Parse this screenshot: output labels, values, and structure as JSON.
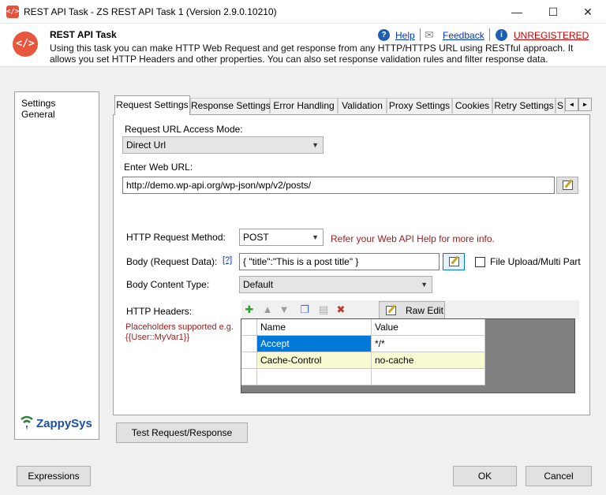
{
  "window": {
    "title": "REST API Task - ZS REST API Task 1 (Version 2.9.0.10210)",
    "app_icon": "</>",
    "controls": {
      "minimize": "—",
      "maximize": "☐",
      "close": "✕"
    }
  },
  "header": {
    "logo_glyph": "</>",
    "title": "REST API Task",
    "description": "Using this task you can make HTTP Web Request and get response from any HTTP/HTTPS URL using RESTful approach. It allows you set HTTP Headers and other properties. You can also set response validation rules and filter response data.",
    "help_label": "Help",
    "feedback_label": "Feedback",
    "unregistered_label": "UNREGISTERED",
    "help_icon": "?",
    "info_icon": "i",
    "mail_icon": "✉"
  },
  "sidebar": {
    "items": [
      {
        "label": "Settings"
      },
      {
        "label": "General"
      }
    ]
  },
  "tabs": [
    {
      "label": "Request Settings",
      "active": true
    },
    {
      "label": "Response Settings"
    },
    {
      "label": "Error Handling"
    },
    {
      "label": "Validation"
    },
    {
      "label": "Proxy Settings"
    },
    {
      "label": "Cookies"
    },
    {
      "label": "Retry Settings"
    },
    {
      "label": "S"
    }
  ],
  "tab_scroll": {
    "left": "◄",
    "right": "►"
  },
  "request": {
    "url_mode_label": "Request URL Access Mode:",
    "url_mode_value": "Direct Url",
    "web_url_label": "Enter Web URL:",
    "web_url_value": "http://demo.wp-api.org/wp-json/wp/v2/posts/",
    "method_label": "HTTP Request Method:",
    "method_value": "POST",
    "method_hint": "Refer your Web API Help for more info.",
    "body_label": "Body (Request Data):",
    "body_help": "[?]",
    "body_value": "{                \"title\":\"This is a post title\" }",
    "file_upload_label": "File Upload/Multi Part",
    "file_upload_checked": false,
    "content_type_label": "Body Content Type:",
    "content_type_value": "Default",
    "headers_label": "HTTP Headers:",
    "placeholder_hint_1": "Placeholders supported e.g.",
    "placeholder_hint_2": "{{User::MyVar1}}"
  },
  "headers_toolbar": {
    "raw_edit_label": "Raw Edit"
  },
  "headers_grid": {
    "columns": [
      "Name",
      "Value"
    ],
    "rows": [
      {
        "name": "Accept",
        "value": "*/*",
        "selected": true
      },
      {
        "name": "Cache-Control",
        "value": "no-cache",
        "selected": false
      },
      {
        "name": "",
        "value": "",
        "selected": false
      }
    ]
  },
  "buttons": {
    "test": "Test Request/Response",
    "expressions": "Expressions",
    "ok": "OK",
    "cancel": "Cancel"
  },
  "brand": {
    "name": "ZappySys"
  },
  "colors": {
    "accent_red": "#e8573d",
    "link_blue": "#0033cc",
    "selection_blue": "#0078d7",
    "row_highlight": "#fafad2",
    "hint_red": "#9b1c1c",
    "brand_green": "#2e7d32",
    "brand_blue": "#1a4fa0"
  }
}
